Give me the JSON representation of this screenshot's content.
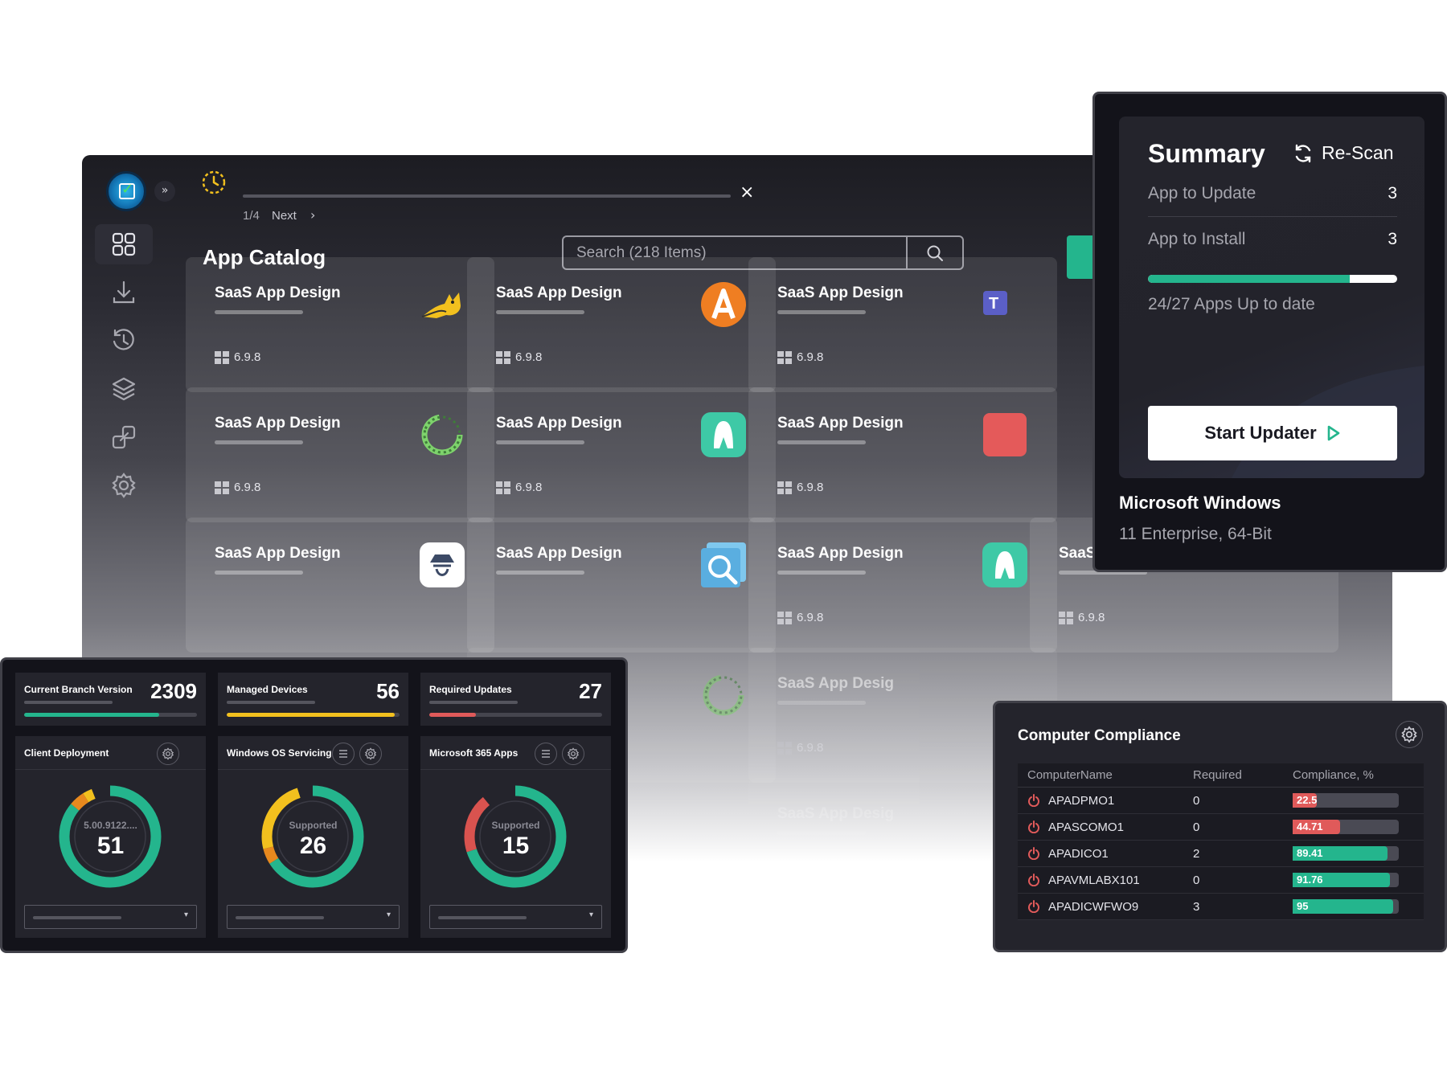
{
  "tour": {
    "step": "1/4",
    "next_label": "Next",
    "close_icon": "×"
  },
  "catalog": {
    "title": "App Catalog",
    "search_placeholder": "Search (218 Items)",
    "cards": [
      {
        "title": "SaaS App Design",
        "version": "6.9.8",
        "icon": "tomcat-icon"
      },
      {
        "title": "SaaS App Design",
        "version": "6.9.8",
        "icon": "orange-a-icon"
      },
      {
        "title": "SaaS App Design",
        "version": "6.9.8",
        "icon": "teams-icon"
      },
      {
        "title": "SaaS App Design",
        "version": "6.9.8",
        "icon": "green-ring-icon"
      },
      {
        "title": "SaaS App Design",
        "version": "6.9.8",
        "icon": "teal-a-icon"
      },
      {
        "title": "SaaS App Design",
        "version": "6.9.8",
        "icon": "red-app-icon"
      },
      {
        "title": "SaaS App Design",
        "version": "",
        "icon": "spy-icon"
      },
      {
        "title": "SaaS App Design",
        "version": "",
        "icon": "magnifier-app-icon"
      },
      {
        "title": "SaaS App Design",
        "version": "6.9.8",
        "icon": "teal-a-icon"
      },
      {
        "title": "SaaS App Design",
        "version": "6.9.8",
        "icon": ""
      },
      {
        "title": "Design",
        "version": "",
        "icon": "green-ring-icon"
      },
      {
        "title": "SaaS App Desig",
        "version": "6.9.8",
        "icon": ""
      },
      {
        "title": "Design",
        "version": "",
        "icon": ""
      },
      {
        "title": "SaaS App Desig",
        "version": "",
        "icon": ""
      }
    ]
  },
  "summary": {
    "title": "Summary",
    "rescan_label": "Re-Scan",
    "rows": [
      {
        "label": "App to Update",
        "value": "3"
      },
      {
        "label": "App to Install",
        "value": "3"
      }
    ],
    "progress_fraction": 0.81,
    "uptodate_text": "24/27 Apps Up to date",
    "start_label": "Start Updater",
    "os_name": "Microsoft Windows",
    "os_desc": "11 Enterprise, 64-Bit"
  },
  "dashboard": {
    "stats": [
      {
        "label": "Current Branch Version",
        "value": "2309",
        "fraction": 0.78,
        "color": "#24b58d"
      },
      {
        "label": "Managed Devices",
        "value": "56",
        "fraction": 0.97,
        "color": "#f2c01e"
      },
      {
        "label": "Required Updates",
        "value": "27",
        "fraction": 0.27,
        "color": "#e05a5a"
      }
    ],
    "gauges": [
      {
        "title": "Client Deployment",
        "sub": "5.00.9122....",
        "value": "51",
        "has_menu": false,
        "segments": [
          {
            "fraction": 0.86,
            "color": "#24b58d"
          },
          {
            "fraction": 0.05,
            "color": "#e8891e"
          },
          {
            "fraction": 0.03,
            "color": "#f2c01e"
          }
        ]
      },
      {
        "title": "Windows OS Servicing",
        "sub": "Supported",
        "value": "26",
        "has_menu": true,
        "segments": [
          {
            "fraction": 0.66,
            "color": "#24b58d"
          },
          {
            "fraction": 0.05,
            "color": "#e8891e"
          },
          {
            "fraction": 0.24,
            "color": "#f2c01e"
          }
        ]
      },
      {
        "title": "Microsoft 365 Apps",
        "sub": "Supported",
        "value": "15",
        "has_menu": true,
        "segments": [
          {
            "fraction": 0.7,
            "color": "#24b58d"
          },
          {
            "fraction": 0.19,
            "color": "#d9534f"
          }
        ]
      }
    ]
  },
  "compliance": {
    "title": "Computer Compliance",
    "headers": [
      "ComputerName",
      "Required",
      "Compliance, %"
    ],
    "rows": [
      {
        "name": "APADPMO1",
        "required": "0",
        "compliance": "22.5",
        "fraction": 0.225,
        "color": "#e05a5a"
      },
      {
        "name": "APASCOMO1",
        "required": "0",
        "compliance": "44.71",
        "fraction": 0.4471,
        "color": "#e05a5a"
      },
      {
        "name": "APADICO1",
        "required": "2",
        "compliance": "89.41",
        "fraction": 0.8941,
        "color": "#24b58d"
      },
      {
        "name": "APAVMLABX101",
        "required": "0",
        "compliance": "91.76",
        "fraction": 0.9176,
        "color": "#24b58d"
      },
      {
        "name": "APADICWFWO9",
        "required": "3",
        "compliance": "95",
        "fraction": 0.95,
        "color": "#24b58d"
      }
    ]
  },
  "colors": {
    "accent": "#24b58d",
    "danger": "#e05a5a",
    "warning": "#f2c01e",
    "panel": "#24242c"
  }
}
